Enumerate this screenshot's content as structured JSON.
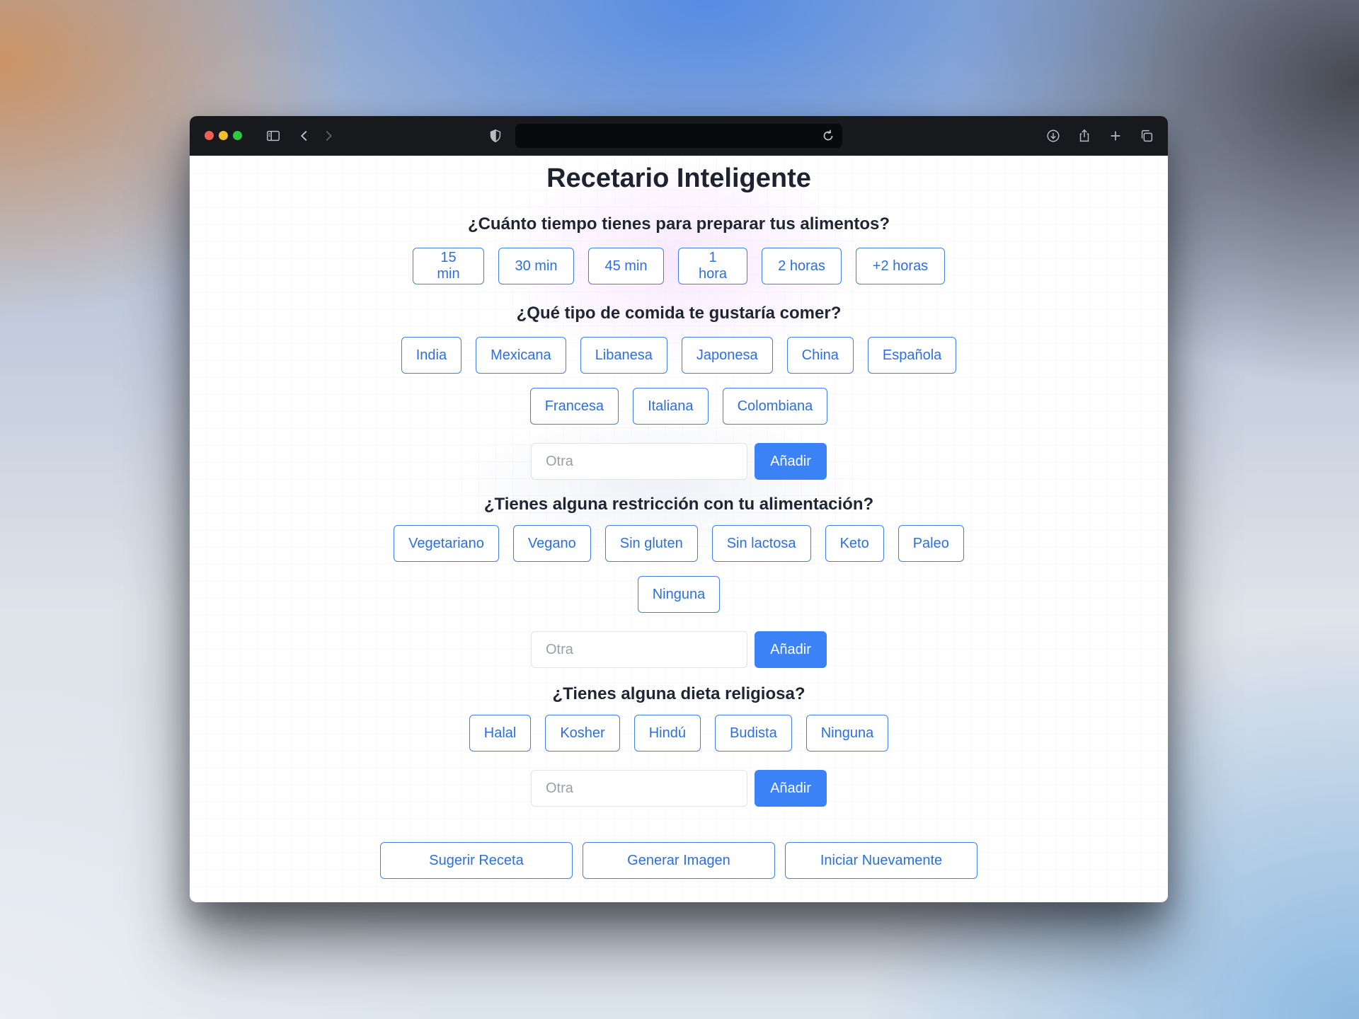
{
  "browser": {
    "url": ""
  },
  "page": {
    "title": "Recetario Inteligente"
  },
  "time": {
    "question": "¿Cuánto tiempo tienes para preparar tus alimentos?",
    "options": [
      "15 min",
      "30 min",
      "45 min",
      "1 hora",
      "2 horas",
      "+2 horas"
    ]
  },
  "cuisine": {
    "question": "¿Qué tipo de comida te gustaría comer?",
    "options": [
      "India",
      "Mexicana",
      "Libanesa",
      "Japonesa",
      "China",
      "Española",
      "Francesa",
      "Italiana",
      "Colombiana"
    ],
    "other_placeholder": "Otra",
    "add_label": "Añadir"
  },
  "restrictions": {
    "question": "¿Tienes alguna restricción con tu alimentación?",
    "options": [
      "Vegetariano",
      "Vegano",
      "Sin gluten",
      "Sin lactosa",
      "Keto",
      "Paleo",
      "Ninguna"
    ],
    "other_placeholder": "Otra",
    "add_label": "Añadir"
  },
  "religious": {
    "question": "¿Tienes alguna dieta religiosa?",
    "options": [
      "Halal",
      "Kosher",
      "Hindú",
      "Budista",
      "Ninguna"
    ],
    "other_placeholder": "Otra",
    "add_label": "Añadir"
  },
  "actions": {
    "suggest": "Sugerir Receta",
    "image": "Generar Imagen",
    "restart": "Iniciar Nuevamente"
  },
  "colors": {
    "accent": "#3b82f6",
    "chip_text": "#2d6fde",
    "heading": "#1c2230"
  }
}
